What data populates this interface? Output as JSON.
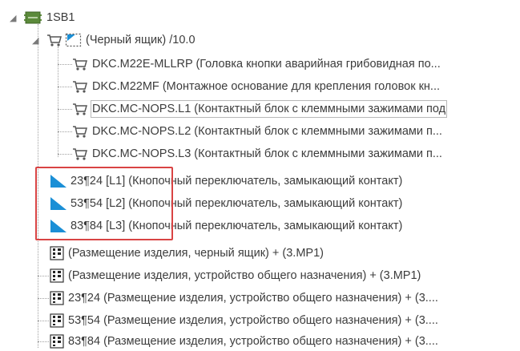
{
  "tree": {
    "root": {
      "label": "1SB1"
    },
    "black_box": {
      "label": "(Черный ящик) /10.0"
    },
    "parts": [
      {
        "label": "DKC.M22E-MLLRP (Головка кнопки аварийная грибовидная по..."
      },
      {
        "label": "DKC.M22MF (Монтажное основание для крепления головок кн..."
      },
      {
        "label": "DKC.MC-NOPS.L1 (Контактный блок с клеммными зажимами под"
      },
      {
        "label": "DKC.MC-NOPS.L2 (Контактный блок с клеммными зажимами п..."
      },
      {
        "label": "DKC.MC-NOPS.L3 (Контактный блок с клеммными зажимами п..."
      }
    ],
    "functions": [
      {
        "label": "23¶24  [L1] (Кнопочный переключатель, замыкающий контакт)"
      },
      {
        "label": "53¶54  [L2] (Кнопочный переключатель, замыкающий контакт)"
      },
      {
        "label": "83¶84  [L3] (Кнопочный переключатель, замыкающий контакт)"
      }
    ],
    "placements": [
      {
        "label": "(Размещение изделия, черный ящик) + (3.MP1)"
      },
      {
        "label": "(Размещение изделия, устройство общего назначения) + (3.MP1)"
      },
      {
        "label": "23¶24 (Размещение изделия, устройство общего назначения) + (3...."
      },
      {
        "label": "53¶54 (Размещение изделия, устройство общего назначения) + (3...."
      },
      {
        "label": "83¶84 (Размещение изделия, устройство общего назначения) + (3...."
      }
    ]
  },
  "colors": {
    "highlight": "#d94444",
    "function_icon": "#1b8fd6",
    "text": "#3c3c3c"
  }
}
